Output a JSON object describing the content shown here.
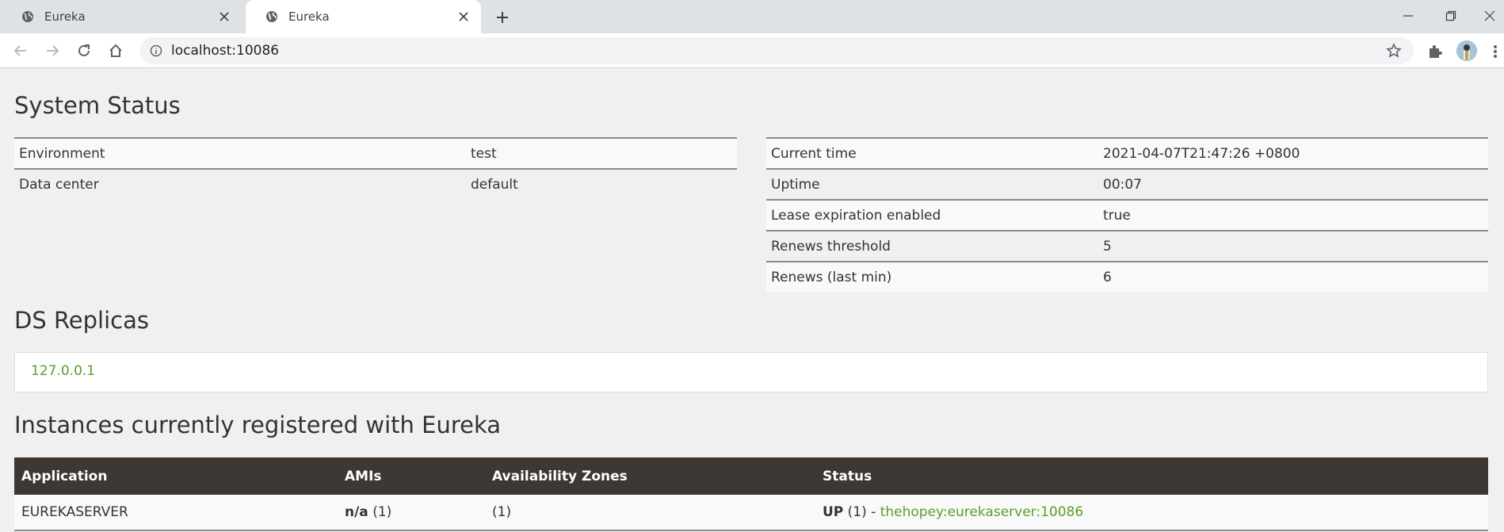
{
  "browser": {
    "tabs": [
      {
        "title": "Eureka",
        "active": false
      },
      {
        "title": "Eureka",
        "active": true
      }
    ],
    "url": "localhost:10086"
  },
  "page": {
    "system_status_title": "System Status",
    "env_table": [
      {
        "label": "Environment",
        "value": "test"
      },
      {
        "label": "Data center",
        "value": "default"
      }
    ],
    "time_table": [
      {
        "label": "Current time",
        "value": "2021-04-07T21:47:26 +0800"
      },
      {
        "label": "Uptime",
        "value": "00:07"
      },
      {
        "label": "Lease expiration enabled",
        "value": "true"
      },
      {
        "label": "Renews threshold",
        "value": "5"
      },
      {
        "label": "Renews (last min)",
        "value": "6"
      }
    ],
    "ds_replicas_title": "DS Replicas",
    "replica": "127.0.0.1",
    "instances_title": "Instances currently registered with Eureka",
    "instances_headers": [
      "Application",
      "AMIs",
      "Availability Zones",
      "Status"
    ],
    "instances": [
      {
        "application": "EUREKASERVER",
        "amis_bold": "n/a",
        "amis_count": " (1)",
        "zones": "(1)",
        "status_prefix": "UP",
        "status_count": " (1) - ",
        "status_link": "thehopey:eurekaserver:10086"
      }
    ]
  },
  "colors": {
    "link": "#5a9e2a",
    "table_header": "#3d3834"
  }
}
